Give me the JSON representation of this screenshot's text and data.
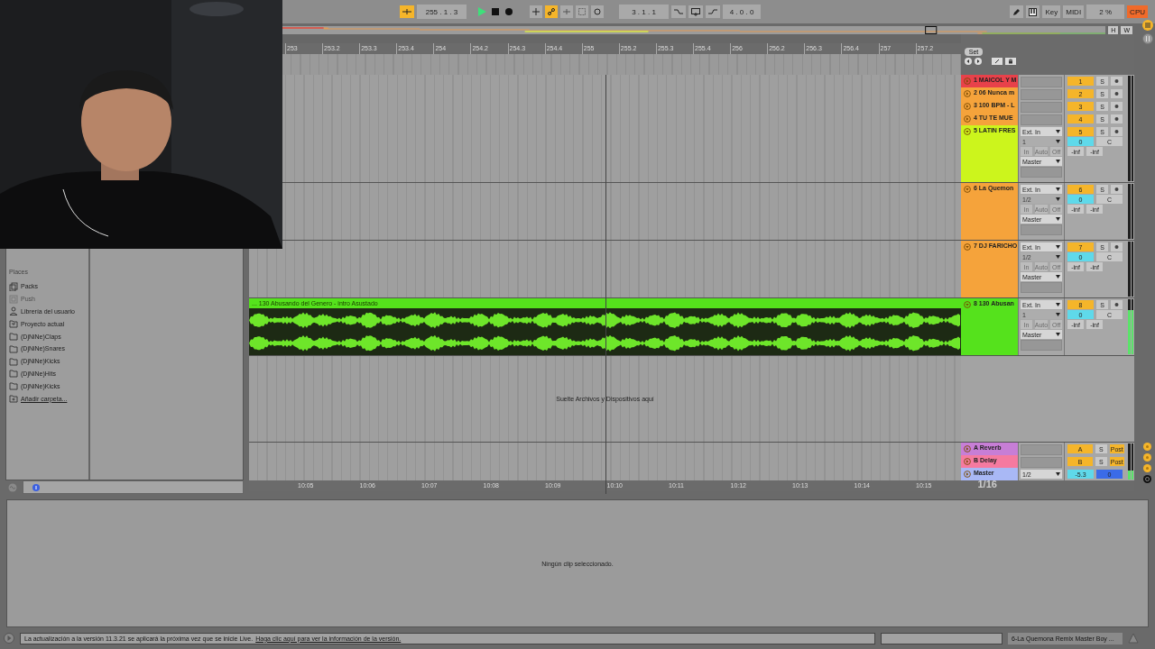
{
  "webcam": {
    "kind": "picture"
  },
  "transport": {
    "follow_on": true,
    "position": "255 . 1 . 3",
    "automation_arm": true,
    "loop_start": "3 . 1 . 1",
    "loop_length": "4 . 0 . 0"
  },
  "top_right": {
    "key": "Key",
    "midi": "MIDI",
    "cpu_load": "2 %",
    "cpu": "CPU"
  },
  "overview": {
    "buttons": [
      "H",
      "W"
    ]
  },
  "set_button": "Set",
  "ruler": [
    "253",
    "253.2",
    "253.3",
    "253.4",
    "254",
    "254.2",
    "254.3",
    "254.4",
    "255",
    "255.2",
    "255.3",
    "255.4",
    "256",
    "256.2",
    "256.3",
    "256.4",
    "257",
    "257.2"
  ],
  "tracks": [
    {
      "kind": "collapsed",
      "name": "1 MAICOL Y M",
      "color": "#e8414a",
      "number": "1",
      "solo": "S"
    },
    {
      "kind": "collapsed",
      "name": "2 06 Nunca m",
      "color": "#f5a33b",
      "number": "2",
      "solo": "S"
    },
    {
      "kind": "collapsed",
      "name": "3 100 BPM - L",
      "color": "#f5a33b",
      "number": "3",
      "solo": "S"
    },
    {
      "kind": "collapsed",
      "name": "4 TU TE MUE",
      "color": "#f5a33b",
      "number": "4",
      "solo": "S"
    },
    {
      "kind": "expanded",
      "name": "5 LATIN FRES",
      "color": "#ccf51c",
      "number": "5",
      "solo": "S",
      "input": "Ext. In",
      "channel": "1",
      "monitor": [
        "In",
        "Auto",
        "Off"
      ],
      "output": "Master",
      "pan": "0",
      "pan_label": "C",
      "peaks": [
        "-inf",
        "-inf"
      ]
    },
    {
      "kind": "expanded",
      "name": "6 La Quemon",
      "color": "#f5a33b",
      "number": "6",
      "solo": "S",
      "input": "Ext. In",
      "channel": "1/2",
      "monitor": [
        "In",
        "Auto",
        "Off"
      ],
      "output": "Master",
      "pan": "0",
      "pan_label": "C",
      "peaks": [
        "-inf",
        "-inf"
      ]
    },
    {
      "kind": "expanded",
      "name": "7 DJ FARICHO",
      "color": "#f5a33b",
      "number": "7",
      "solo": "S",
      "input": "Ext. In",
      "channel": "1/2",
      "monitor": [
        "In",
        "Auto",
        "Off"
      ],
      "output": "Master",
      "pan": "0",
      "pan_label": "C",
      "peaks": [
        "-inf",
        "-inf"
      ]
    },
    {
      "kind": "expanded",
      "name": "8 130 Abusan",
      "color": "#55e21c",
      "number": "8",
      "solo": "S",
      "input": "Ext. In",
      "channel": "1",
      "monitor": [
        "In",
        "Auto",
        "Off"
      ],
      "output": "Master",
      "pan": "0",
      "pan_label": "C",
      "peaks": [
        "-inf",
        "-inf"
      ],
      "level": 0.8,
      "clip": "... 130 Abusando del Genero - intro Asustado"
    },
    {
      "kind": "drop",
      "hint": "Suelte Archivos y Dispositivos aquí"
    },
    {
      "kind": "return",
      "name": "A Reverb",
      "color": "#c77ed6",
      "number": "A",
      "solo": "S",
      "send": "Post"
    },
    {
      "kind": "return",
      "name": "B Delay",
      "color": "#f57aa0",
      "number": "B",
      "solo": "S",
      "send": "Post"
    },
    {
      "kind": "master",
      "name": "Master",
      "color": "#a9b8f5",
      "output": "1/2",
      "volume": "-5.3",
      "pan": "0",
      "level": 0.85
    }
  ],
  "time_ruler": [
    "10:05",
    "10:06",
    "10:07",
    "10:08",
    "10:09",
    "10:10",
    "10:11",
    "10:12",
    "10:13",
    "10:14",
    "10:15"
  ],
  "grid_setting": "1/16",
  "browser": {
    "header": "Places",
    "items": [
      {
        "label": "Packs",
        "kind": "packs",
        "disabled": false
      },
      {
        "label": "Push",
        "kind": "push",
        "disabled": true
      },
      {
        "label": "Librería del usuario",
        "kind": "user",
        "disabled": false
      },
      {
        "label": "Proyecto actual",
        "kind": "project",
        "disabled": false
      },
      {
        "label": "(DjNiNe)Claps",
        "kind": "folder",
        "disabled": false
      },
      {
        "label": "(DjNiNe)Snares",
        "kind": "folder",
        "disabled": false
      },
      {
        "label": "(DjNiNe)Kicks",
        "kind": "folder",
        "disabled": false
      },
      {
        "label": "(DjNiNe)Hits",
        "kind": "folder",
        "disabled": false
      },
      {
        "label": "(DjNiNe)Kicks",
        "kind": "folder",
        "disabled": false
      },
      {
        "label": "Añadir carpeta...",
        "kind": "add",
        "disabled": false
      }
    ]
  },
  "detail": "Ningún clip seleccionado.",
  "status": {
    "message": "La actualización a la versión 11.3.21 se aplicará la próxima vez que se inicie Live.",
    "link": "Haga clic aquí para ver la información de la versión.",
    "current_set": "6-La Quemona Remix  Master Boy  ..."
  }
}
